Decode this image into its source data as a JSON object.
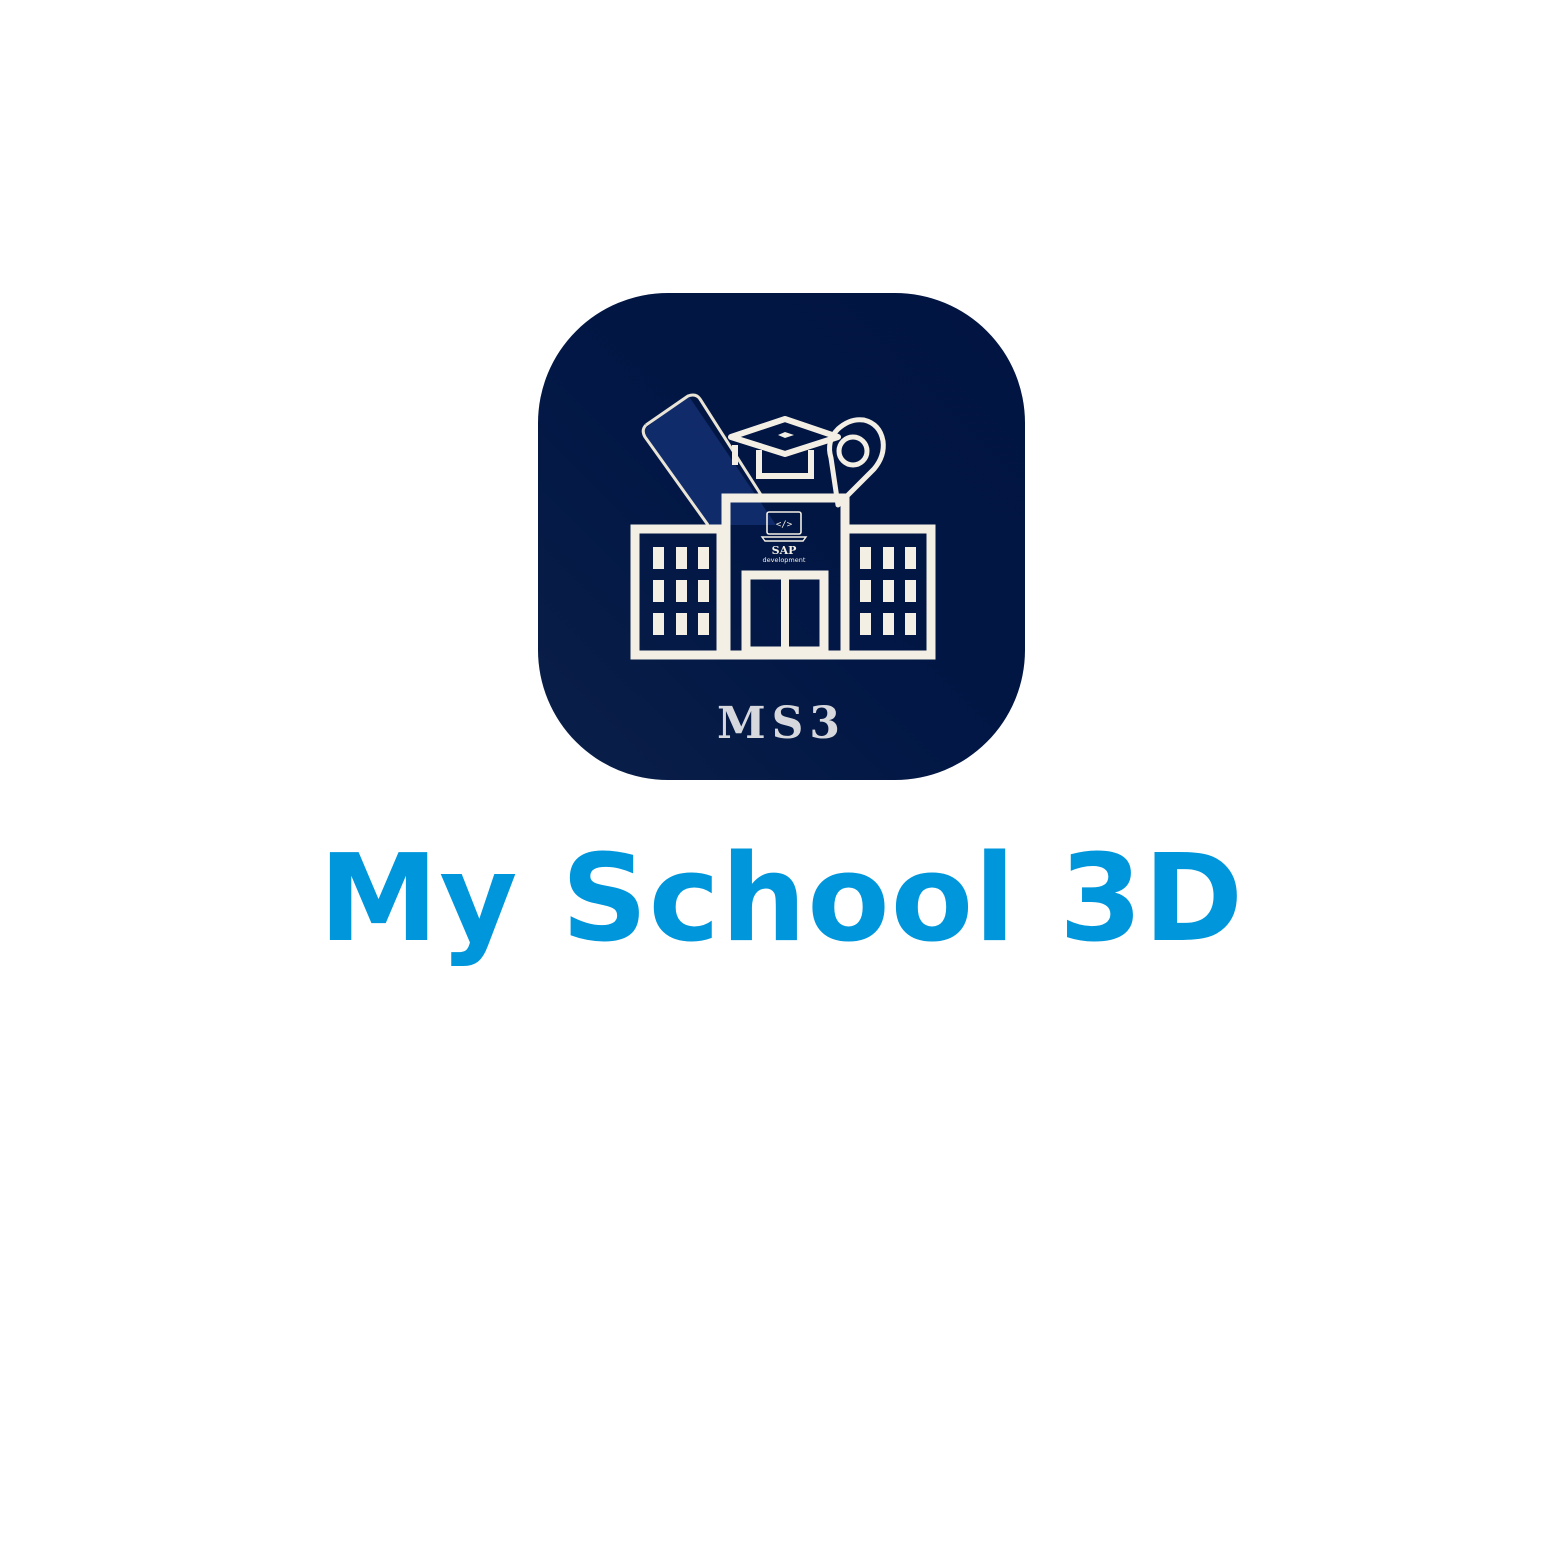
{
  "icon": {
    "background": "#021745",
    "line_color": "#f3efe4",
    "label": "MS3",
    "badge_title": "SAP",
    "badge_subtitle": "development",
    "code_glyph": "</>"
  },
  "app_name": "My School 3D",
  "colors": {
    "app_name": "#0096db",
    "label": "#d6d8de"
  }
}
